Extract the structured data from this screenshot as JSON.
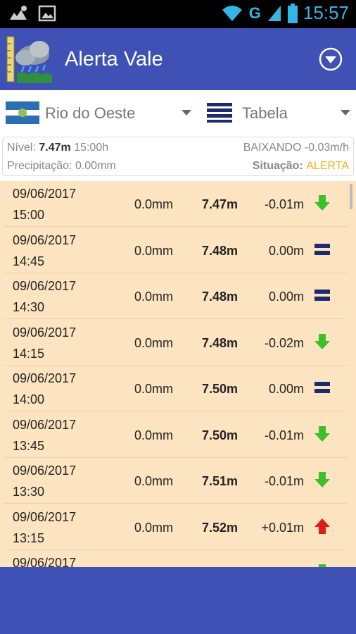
{
  "status_bar": {
    "network": "G",
    "time": "15:57"
  },
  "app": {
    "title": "Alerta Vale"
  },
  "selectors": {
    "station": "Rio do Oeste",
    "view": "Tabela"
  },
  "summary": {
    "level_label": "Nível:",
    "level_value": "7.47m",
    "level_time": "15:00h",
    "trend": "BAIXANDO -0.03m/h",
    "precip": "Precipitação: 0.00mm",
    "situation_label": "Situação:",
    "situation_value": "ALERTA"
  },
  "colors": {
    "primary": "#3f51b5",
    "row_bg": "#fde4c0",
    "down": "#3cbf2a",
    "up": "#d8201a",
    "stable": "#1f2a6e",
    "alert": "#f2b21b"
  },
  "rows": [
    {
      "date": "09/06/2017",
      "time": "15:00",
      "rain": "0.0mm",
      "level": "7.47m",
      "delta": "-0.01m",
      "trend": "down"
    },
    {
      "date": "09/06/2017",
      "time": "14:45",
      "rain": "0.0mm",
      "level": "7.48m",
      "delta": "0.00m",
      "trend": "stable"
    },
    {
      "date": "09/06/2017",
      "time": "14:30",
      "rain": "0.0mm",
      "level": "7.48m",
      "delta": "0.00m",
      "trend": "stable"
    },
    {
      "date": "09/06/2017",
      "time": "14:15",
      "rain": "0.0mm",
      "level": "7.48m",
      "delta": "-0.02m",
      "trend": "down"
    },
    {
      "date": "09/06/2017",
      "time": "14:00",
      "rain": "0.0mm",
      "level": "7.50m",
      "delta": "0.00m",
      "trend": "stable"
    },
    {
      "date": "09/06/2017",
      "time": "13:45",
      "rain": "0.0mm",
      "level": "7.50m",
      "delta": "-0.01m",
      "trend": "down"
    },
    {
      "date": "09/06/2017",
      "time": "13:30",
      "rain": "0.0mm",
      "level": "7.51m",
      "delta": "-0.01m",
      "trend": "down"
    },
    {
      "date": "09/06/2017",
      "time": "13:15",
      "rain": "0.0mm",
      "level": "7.52m",
      "delta": "+0.01m",
      "trend": "up"
    },
    {
      "date": "09/06/2017",
      "time": "",
      "rain": "",
      "level": "",
      "delta": "",
      "trend": "down"
    }
  ]
}
